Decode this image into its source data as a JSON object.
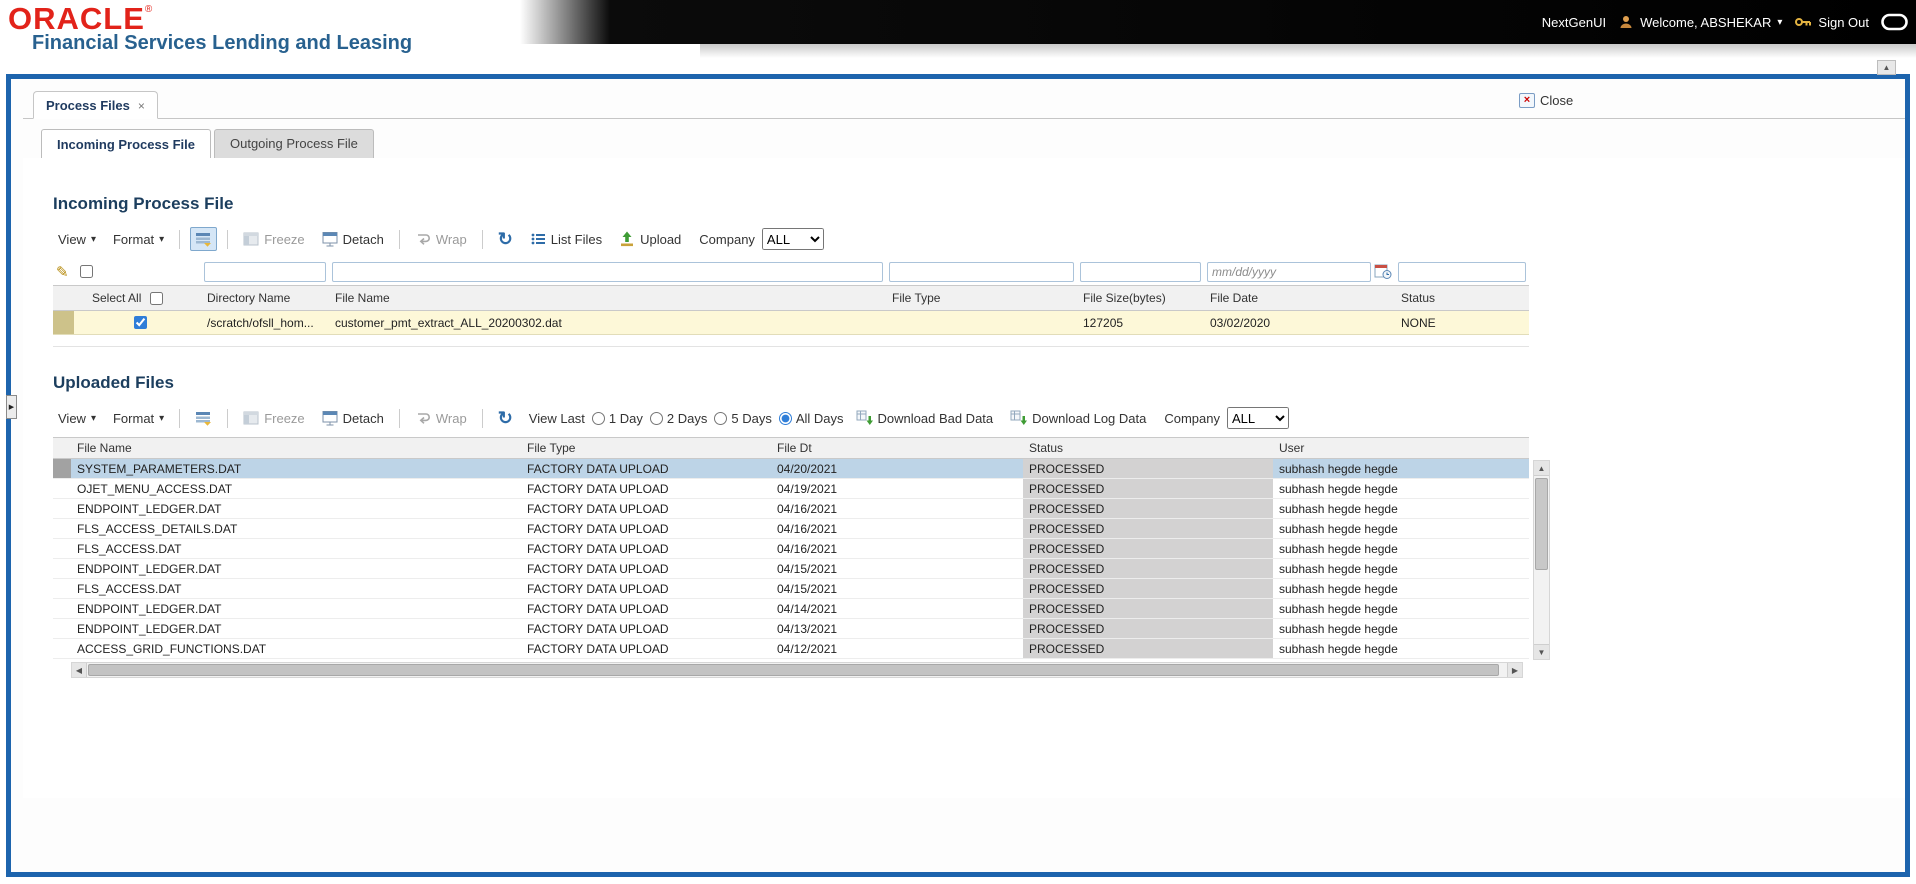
{
  "header": {
    "logo": "ORACLE",
    "logo_reg": "®",
    "subtitle": "Financial Services Lending and Leasing",
    "nextgen_label": "NextGenUI",
    "welcome_label": "Welcome, ABSHEKAR",
    "signout_label": "Sign Out"
  },
  "window": {
    "tab_label": "Process Files",
    "close_label": "Close"
  },
  "subtabs": [
    {
      "label": "Incoming Process File"
    },
    {
      "label": "Outgoing Process File"
    }
  ],
  "incoming": {
    "title": "Incoming Process File",
    "toolbar": {
      "view": "View",
      "format": "Format",
      "freeze": "Freeze",
      "detach": "Detach",
      "wrap": "Wrap",
      "list_files": "List Files",
      "upload": "Upload",
      "company_label": "Company",
      "company_value": "ALL"
    },
    "filters": {
      "date_placeholder": "mm/dd/yyyy"
    },
    "columns": [
      "Select All",
      "Directory Name",
      "File Name",
      "File Type",
      "File Size(bytes)",
      "File Date",
      "Status"
    ],
    "rows": [
      {
        "selected": true,
        "directory_name": "/scratch/ofsll_hom...",
        "file_name": "customer_pmt_extract_ALL_20200302.dat",
        "file_type": "",
        "file_size": "127205",
        "file_date": "03/02/2020",
        "status": "NONE"
      }
    ]
  },
  "uploaded": {
    "title": "Uploaded Files",
    "toolbar": {
      "view": "View",
      "format": "Format",
      "freeze": "Freeze",
      "detach": "Detach",
      "wrap": "Wrap",
      "view_last_label": "View Last",
      "view_last_options": [
        "1 Day",
        "2 Days",
        "5 Days",
        "All Days"
      ],
      "view_last_selected": "All Days",
      "download_bad": "Download Bad Data",
      "download_log": "Download Log Data",
      "company_label": "Company",
      "company_value": "ALL"
    },
    "columns": [
      "File Name",
      "File Type",
      "File Dt",
      "Status",
      "User"
    ],
    "selected_row_index": 0,
    "rows": [
      [
        "SYSTEM_PARAMETERS.DAT",
        "FACTORY DATA UPLOAD",
        "04/20/2021",
        "PROCESSED",
        "subhash hegde hegde"
      ],
      [
        "OJET_MENU_ACCESS.DAT",
        "FACTORY DATA UPLOAD",
        "04/19/2021",
        "PROCESSED",
        "subhash hegde hegde"
      ],
      [
        "ENDPOINT_LEDGER.DAT",
        "FACTORY DATA UPLOAD",
        "04/16/2021",
        "PROCESSED",
        "subhash hegde hegde"
      ],
      [
        "FLS_ACCESS_DETAILS.DAT",
        "FACTORY DATA UPLOAD",
        "04/16/2021",
        "PROCESSED",
        "subhash hegde hegde"
      ],
      [
        "FLS_ACCESS.DAT",
        "FACTORY DATA UPLOAD",
        "04/16/2021",
        "PROCESSED",
        "subhash hegde hegde"
      ],
      [
        "ENDPOINT_LEDGER.DAT",
        "FACTORY DATA UPLOAD",
        "04/15/2021",
        "PROCESSED",
        "subhash hegde hegde"
      ],
      [
        "FLS_ACCESS.DAT",
        "FACTORY DATA UPLOAD",
        "04/15/2021",
        "PROCESSED",
        "subhash hegde hegde"
      ],
      [
        "ENDPOINT_LEDGER.DAT",
        "FACTORY DATA UPLOAD",
        "04/14/2021",
        "PROCESSED",
        "subhash hegde hegde"
      ],
      [
        "ENDPOINT_LEDGER.DAT",
        "FACTORY DATA UPLOAD",
        "04/13/2021",
        "PROCESSED",
        "subhash hegde hegde"
      ],
      [
        "ACCESS_GRID_FUNCTIONS.DAT",
        "FACTORY DATA UPLOAD",
        "04/12/2021",
        "PROCESSED",
        "subhash hegde hegde"
      ]
    ]
  },
  "icons": {
    "caret": "▾",
    "refresh": "↻",
    "close": "×",
    "close_small": "×",
    "pencil": "✎",
    "up_arrow": "▲",
    "down_arrow": "▼",
    "left_arrow": "◀",
    "right_arrow": "▶",
    "splitter": "▶"
  },
  "colors": {
    "oracle_red": "#e2231a",
    "brand_blue": "#28618f",
    "frame_blue": "#1d64ad",
    "selected_row_blue": "#bdd4e7",
    "incoming_row_yellow": "#fdf8d8",
    "status_cell_gray": "#d3d2d2",
    "title_navy": "#1c3e5e"
  }
}
